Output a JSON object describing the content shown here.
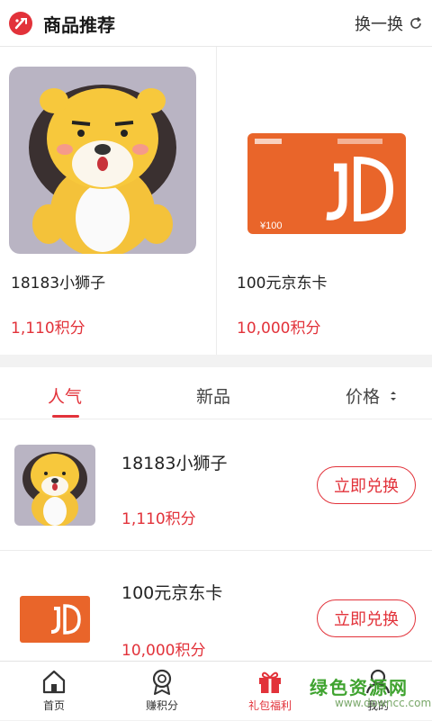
{
  "header": {
    "title": "商品推荐",
    "refresh_label": "换一换"
  },
  "recommend": [
    {
      "name": "18183小狮子",
      "points": "1,110积分",
      "image": "plush-lion"
    },
    {
      "name": "100元京东卡",
      "points": "10,000积分",
      "image": "jd-card",
      "card_value": "¥100"
    }
  ],
  "tabs": [
    {
      "label": "人气",
      "active": true
    },
    {
      "label": "新品",
      "active": false
    },
    {
      "label": "价格",
      "active": false
    }
  ],
  "list": [
    {
      "name": "18183小狮子",
      "points": "1,110积分",
      "button": "立即兑换",
      "image": "plush-lion"
    },
    {
      "name": "100元京东卡",
      "points": "10,000积分",
      "button": "立即兑换",
      "image": "jd-card"
    }
  ],
  "bottom_nav": [
    {
      "label": "首页",
      "icon": "home-icon"
    },
    {
      "label": "赚积分",
      "icon": "medal-icon"
    },
    {
      "label": "礼包福利",
      "icon": "gift-icon",
      "active": true
    },
    {
      "label": "我的",
      "icon": "user-icon"
    }
  ],
  "watermark": {
    "main": "绿色资源网",
    "sub": "www.downcc.com"
  },
  "colors": {
    "accent": "#e2323a",
    "jd_orange": "#e9652a",
    "background": "#f2f2f2"
  }
}
